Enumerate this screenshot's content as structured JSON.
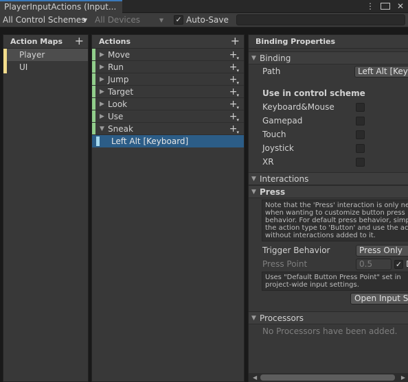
{
  "window": {
    "tab_title": "PlayerInputActions (Input...",
    "menu_glyph": "⋮"
  },
  "toolbar": {
    "control_schemes": "All Control Schemes",
    "devices": "All Devices",
    "auto_save_label": "Auto-Save",
    "auto_save_checked": "✓",
    "search_value": ""
  },
  "action_maps": {
    "header": "Action Maps",
    "add_glyph": "+",
    "items": [
      {
        "label": "Player",
        "selected": true
      },
      {
        "label": "UI",
        "selected": false
      }
    ]
  },
  "actions": {
    "header": "Actions",
    "add_glyph": "+",
    "items": [
      {
        "label": "Move",
        "expanded": false
      },
      {
        "label": "Run",
        "expanded": false
      },
      {
        "label": "Jump",
        "expanded": false
      },
      {
        "label": "Target",
        "expanded": false
      },
      {
        "label": "Look",
        "expanded": false
      },
      {
        "label": "Use",
        "expanded": false
      },
      {
        "label": "Sneak",
        "expanded": true
      }
    ],
    "selected_binding": "Left Alt [Keyboard]"
  },
  "binding_properties": {
    "header": "Binding Properties",
    "binding_section": "Binding",
    "path_label": "Path",
    "path_value": "Left Alt [Keyb",
    "scheme_header": "Use in control scheme",
    "schemes": [
      "Keyboard&Mouse",
      "Gamepad",
      "Touch",
      "Joystick",
      "XR"
    ],
    "interactions_section": "Interactions",
    "press_section": "Press",
    "press_help": "Note that the 'Press' interaction is only nec\nwhen wanting to customize button press\nbehavior. For default press behavior, simpl\nthe action type to 'Button' and use the acti\nwithout interactions added to it.",
    "trigger_behavior_label": "Trigger Behavior",
    "trigger_behavior_value": "Press Only",
    "press_point_label": "Press Point",
    "press_point_value": "0.5",
    "press_point_default_checked": "✓",
    "press_point_default_label": "D",
    "press_point_help": "Uses \"Default Button Press Point\" set in\nproject-wide input settings.",
    "open_input_settings": "Open Input Se",
    "processors_section": "Processors",
    "processors_empty": "No Processors have been added."
  },
  "colors": {
    "accent_tab": "#3a79bb",
    "map_marker": "#f2dc8b",
    "action_marker": "#91cd8b",
    "binding_marker": "#a5d9ef",
    "selection": "#2c5d87"
  }
}
